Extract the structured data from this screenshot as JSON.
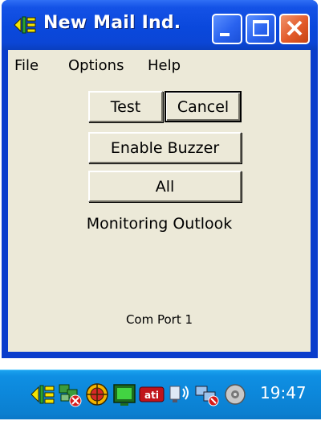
{
  "window": {
    "title": "New Mail Ind.",
    "icon": "mail-indicator-icon",
    "controls": [
      "minimize-icon",
      "maximize-icon",
      "close-icon"
    ]
  },
  "menu": {
    "file": "File",
    "options": "Options",
    "help": "Help"
  },
  "buttons": {
    "test": "Test",
    "cancel": "Cancel",
    "enable_buzzer": "Enable  Buzzer",
    "all": "All"
  },
  "status": {
    "monitoring": "Monitoring Outlook",
    "port": "Com Port 1"
  },
  "taskbar": {
    "tray_icons": [
      "mail-indicator-icon",
      "network-disconnected-icon",
      "globe-icon",
      "monitor-icon",
      "ati-icon",
      "speaker-icon",
      "network-connection-icon",
      "cd-icon"
    ],
    "clock": "19:47"
  },
  "colors": {
    "titlebar": "#0a48dc",
    "client": "#ece9d8",
    "taskbar": "#0c87da",
    "close_button": "#e25a2a"
  }
}
